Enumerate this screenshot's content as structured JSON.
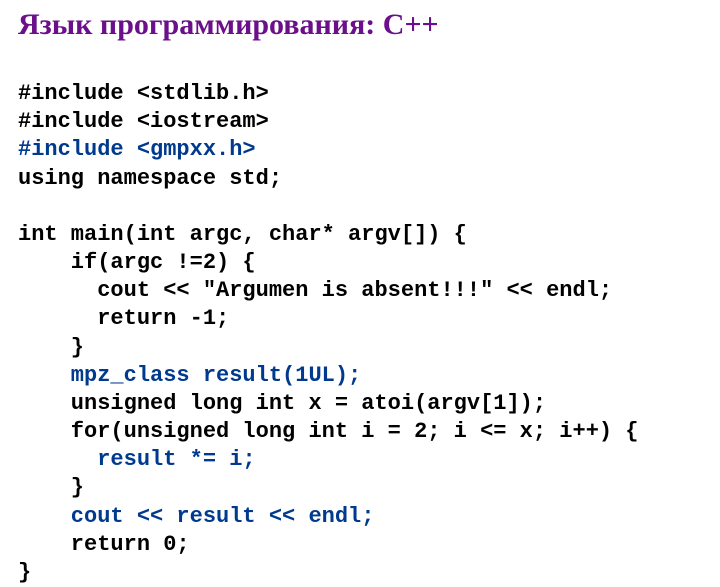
{
  "title": {
    "prefix": "Язык программирования: ",
    "lang": "C++"
  },
  "code": {
    "l1": "#include <stdlib.h>",
    "l2": "#include <iostream>",
    "l3": "#include <gmpxx.h>",
    "l4": "using namespace std;",
    "l5": "",
    "l6": "int main(int argc, char* argv[]) {",
    "l7": "    if(argc !=2) {",
    "l8": "      cout << \"Argumen is absent!!!\" << endl;",
    "l9": "      return -1;",
    "l10": "    }",
    "l11": "    mpz_class result(1UL);",
    "l12": "    unsigned long int x = atoi(argv[1]);",
    "l13": "    for(unsigned long int i = 2; i <= x; i++) {",
    "l14": "      result *= i;",
    "l15": "    }",
    "l16": "    cout << result << endl;",
    "l17": "    return 0;",
    "l18": "}"
  }
}
